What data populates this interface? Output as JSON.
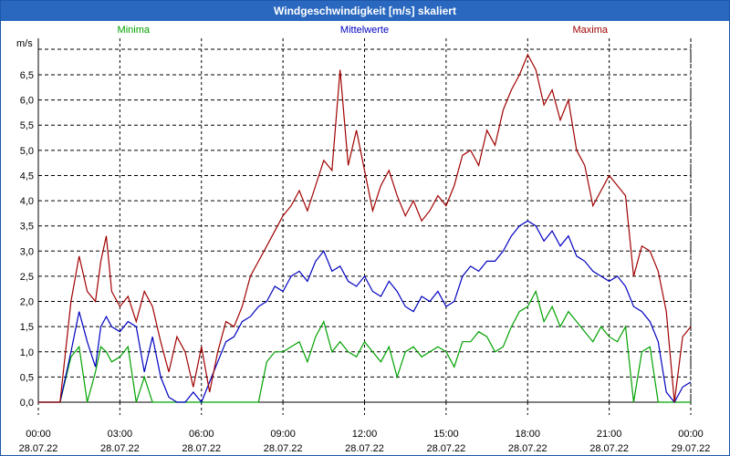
{
  "chart_data": {
    "type": "line",
    "title": "Windgeschwindigkeit [m/s] skaliert",
    "ylabel": "m/s",
    "ylim": [
      0,
      7
    ],
    "y_ticks": [
      {
        "v": 0.0,
        "label": "0,0"
      },
      {
        "v": 0.5,
        "label": "0,5"
      },
      {
        "v": 1.0,
        "label": "1,0"
      },
      {
        "v": 1.5,
        "label": "1,5"
      },
      {
        "v": 2.0,
        "label": "2,0"
      },
      {
        "v": 2.5,
        "label": "2,5"
      },
      {
        "v": 3.0,
        "label": "3,0"
      },
      {
        "v": 3.5,
        "label": "3,5"
      },
      {
        "v": 4.0,
        "label": "4,0"
      },
      {
        "v": 4.5,
        "label": "4,5"
      },
      {
        "v": 5.0,
        "label": "5,0"
      },
      {
        "v": 5.5,
        "label": "5,5"
      },
      {
        "v": 6.0,
        "label": "6,0"
      },
      {
        "v": 6.5,
        "label": "6,5"
      }
    ],
    "xlim": [
      0,
      24
    ],
    "x_ticks": [
      {
        "h": 0,
        "time": "00:00",
        "date": "28.07.22"
      },
      {
        "h": 3,
        "time": "03:00",
        "date": "28.07.22"
      },
      {
        "h": 6,
        "time": "06:00",
        "date": "28.07.22"
      },
      {
        "h": 9,
        "time": "09:00",
        "date": "28.07.22"
      },
      {
        "h": 12,
        "time": "12:00",
        "date": "28.07.22"
      },
      {
        "h": 15,
        "time": "15:00",
        "date": "28.07.22"
      },
      {
        "h": 18,
        "time": "18:00",
        "date": "28.07.22"
      },
      {
        "h": 21,
        "time": "21:00",
        "date": "28.07.22"
      },
      {
        "h": 24,
        "time": "00:00",
        "date": "29.07.22"
      }
    ],
    "grid": true,
    "x": [
      0.8,
      1.2,
      1.5,
      1.8,
      2.1,
      2.3,
      2.5,
      2.7,
      3.0,
      3.3,
      3.6,
      3.9,
      4.2,
      4.5,
      4.8,
      5.1,
      5.4,
      5.7,
      6.0,
      6.3,
      6.6,
      6.9,
      7.2,
      7.5,
      7.8,
      8.1,
      8.4,
      8.7,
      9.0,
      9.3,
      9.6,
      9.9,
      10.2,
      10.5,
      10.8,
      11.1,
      11.4,
      11.7,
      12.0,
      12.3,
      12.6,
      12.9,
      13.2,
      13.5,
      13.8,
      14.1,
      14.4,
      14.7,
      15.0,
      15.3,
      15.6,
      15.9,
      16.2,
      16.5,
      16.8,
      17.1,
      17.4,
      17.7,
      18.0,
      18.3,
      18.6,
      18.9,
      19.2,
      19.5,
      19.8,
      20.1,
      20.4,
      20.7,
      21.0,
      21.3,
      21.6,
      21.9,
      22.2,
      22.5,
      22.8,
      23.1,
      23.4,
      23.7,
      24.0
    ],
    "series": [
      {
        "name": "Minima",
        "color": "#00a000",
        "values": [
          0.0,
          0.9,
          1.1,
          0.0,
          0.6,
          1.1,
          1.0,
          0.8,
          0.9,
          1.1,
          0.0,
          0.5,
          0.0,
          0.0,
          0.0,
          0.0,
          0.0,
          0.0,
          0.0,
          0.0,
          0.0,
          0.0,
          0.0,
          0.0,
          0.0,
          0.0,
          0.8,
          1.0,
          1.0,
          1.1,
          1.2,
          0.8,
          1.3,
          1.6,
          1.0,
          1.2,
          1.0,
          0.9,
          1.2,
          1.0,
          0.8,
          1.1,
          0.5,
          1.0,
          1.1,
          0.9,
          1.0,
          1.1,
          1.0,
          0.7,
          1.2,
          1.2,
          1.4,
          1.3,
          1.0,
          1.1,
          1.5,
          1.8,
          1.9,
          2.2,
          1.6,
          1.9,
          1.5,
          1.8,
          1.6,
          1.4,
          1.2,
          1.5,
          1.3,
          1.2,
          1.5,
          0.0,
          1.0,
          1.1,
          0.0,
          0.0,
          0.0,
          0.0,
          0.0
        ]
      },
      {
        "name": "Mittelwerte",
        "color": "#0000c0",
        "values": [
          0.0,
          1.0,
          1.8,
          1.2,
          0.7,
          1.5,
          1.7,
          1.5,
          1.4,
          1.6,
          1.5,
          0.6,
          1.3,
          0.5,
          0.1,
          0.0,
          0.0,
          0.2,
          0.0,
          0.4,
          0.8,
          1.2,
          1.3,
          1.6,
          1.7,
          1.9,
          2.0,
          2.3,
          2.2,
          2.5,
          2.6,
          2.4,
          2.8,
          3.0,
          2.6,
          2.7,
          2.4,
          2.3,
          2.5,
          2.2,
          2.1,
          2.4,
          2.2,
          1.9,
          1.8,
          2.1,
          2.0,
          2.2,
          1.9,
          2.0,
          2.5,
          2.7,
          2.6,
          2.8,
          2.8,
          3.0,
          3.3,
          3.5,
          3.6,
          3.5,
          3.2,
          3.4,
          3.1,
          3.3,
          2.9,
          2.8,
          2.6,
          2.5,
          2.4,
          2.5,
          2.3,
          1.9,
          1.8,
          1.6,
          1.2,
          0.2,
          0.0,
          0.3,
          0.4
        ]
      },
      {
        "name": "Maxima",
        "color": "#a00000",
        "values": [
          0.0,
          2.0,
          2.9,
          2.2,
          2.0,
          2.8,
          3.3,
          2.2,
          1.9,
          2.1,
          1.6,
          2.2,
          1.9,
          1.2,
          0.6,
          1.3,
          1.0,
          0.3,
          1.1,
          0.2,
          1.0,
          1.6,
          1.5,
          1.9,
          2.5,
          2.8,
          3.1,
          3.4,
          3.7,
          3.9,
          4.2,
          3.8,
          4.3,
          4.8,
          4.6,
          6.6,
          4.7,
          5.4,
          4.6,
          3.8,
          4.3,
          4.6,
          4.1,
          3.7,
          4.0,
          3.6,
          3.8,
          4.1,
          3.9,
          4.3,
          4.9,
          5.0,
          4.7,
          5.4,
          5.1,
          5.8,
          6.2,
          6.5,
          6.9,
          6.6,
          5.9,
          6.2,
          5.6,
          6.0,
          5.0,
          4.7,
          3.9,
          4.2,
          4.5,
          4.3,
          4.1,
          2.5,
          3.1,
          3.0,
          2.6,
          1.8,
          0.0,
          1.3,
          1.5
        ]
      }
    ]
  }
}
